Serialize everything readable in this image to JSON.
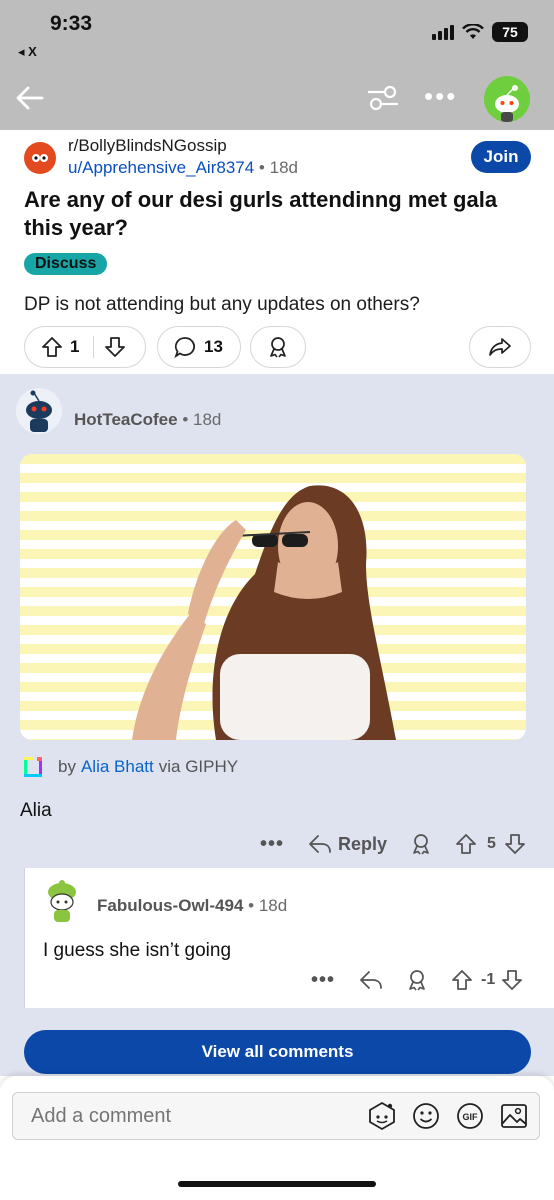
{
  "status_bar": {
    "time": "9:33",
    "back_app": "◂ X",
    "battery": "75"
  },
  "post": {
    "subreddit": "r/BollyBlindsNGossip",
    "author": "u/Apprehensive_Air8374",
    "age": "18d",
    "join_label": "Join",
    "title": "Are any of our desi gurls attendinng met gala this year?",
    "flair": "Discuss",
    "body": "DP is not attending but any updates on others?",
    "votes": "1",
    "comments": "13"
  },
  "comment": {
    "author": "HotTeaCofee",
    "age": "18d",
    "giphy": {
      "by": "by",
      "artist": "Alia Bhatt",
      "via": "via GIPHY"
    },
    "body": "Alia",
    "more": "•••",
    "reply_label": "Reply",
    "votes": "5"
  },
  "reply": {
    "author": "Fabulous-Owl-494",
    "age": "18d",
    "body": "I guess she isn’t going",
    "more": "•••",
    "votes": "-1"
  },
  "view_all_label": "View all comments",
  "composer": {
    "placeholder": "Add a comment",
    "gif_label": "GIF"
  },
  "colors": {
    "accent": "#0b48a8",
    "flair": "#17a5a6",
    "comment_bg": "#dfe3ef",
    "link": "#0a63c9"
  }
}
